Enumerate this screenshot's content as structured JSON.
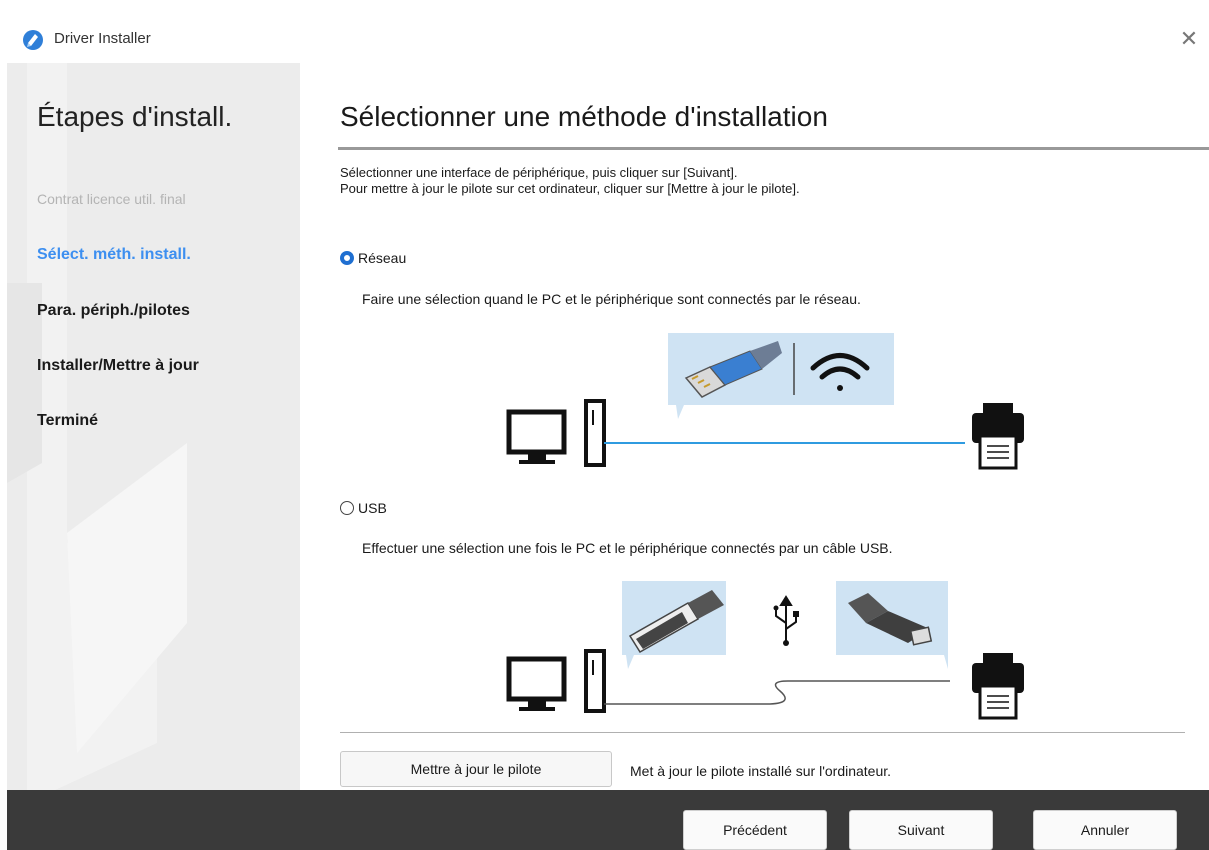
{
  "window": {
    "title": "Driver Installer",
    "close_glyph": "✕",
    "app_icon": "driver-installer-icon"
  },
  "sidebar": {
    "title": "Étapes d'install.",
    "steps": [
      {
        "label": "Contrat licence util. final",
        "state": "done"
      },
      {
        "label": "Sélect. méth. install.",
        "state": "active"
      },
      {
        "label": "Para. périph./pilotes",
        "state": "pending"
      },
      {
        "label": "Installer/Mettre à jour",
        "state": "pending"
      },
      {
        "label": "Terminé",
        "state": "pending"
      }
    ]
  },
  "main": {
    "title": "Sélectionner une méthode d'installation",
    "description_line1": "Sélectionner une interface de périphérique, puis cliquer sur [Suivant].",
    "description_line2": "Pour mettre à jour le pilote sur cet ordinateur, cliquer sur [Mettre à jour le pilote].",
    "options": [
      {
        "label": "Réseau",
        "selected": true,
        "description": "Faire une sélection quand le PC et le périphérique sont connectés par le réseau."
      },
      {
        "label": "USB",
        "selected": false,
        "description": "Effectuer une sélection une fois le PC et le périphérique connectés par un câble USB."
      }
    ],
    "update_button": "Mettre à jour le pilote",
    "update_note": "Met à jour le pilote installé sur l'ordinateur."
  },
  "footer": {
    "back": "Précédent",
    "next": "Suivant",
    "cancel": "Annuler"
  },
  "colors": {
    "accent": "#3d8ff0",
    "radio": "#1f6fd1",
    "cable": "#2f9be0",
    "bubble": "#cfe3f3",
    "footer": "#3a3a3a",
    "sidebar": "#ececec"
  }
}
